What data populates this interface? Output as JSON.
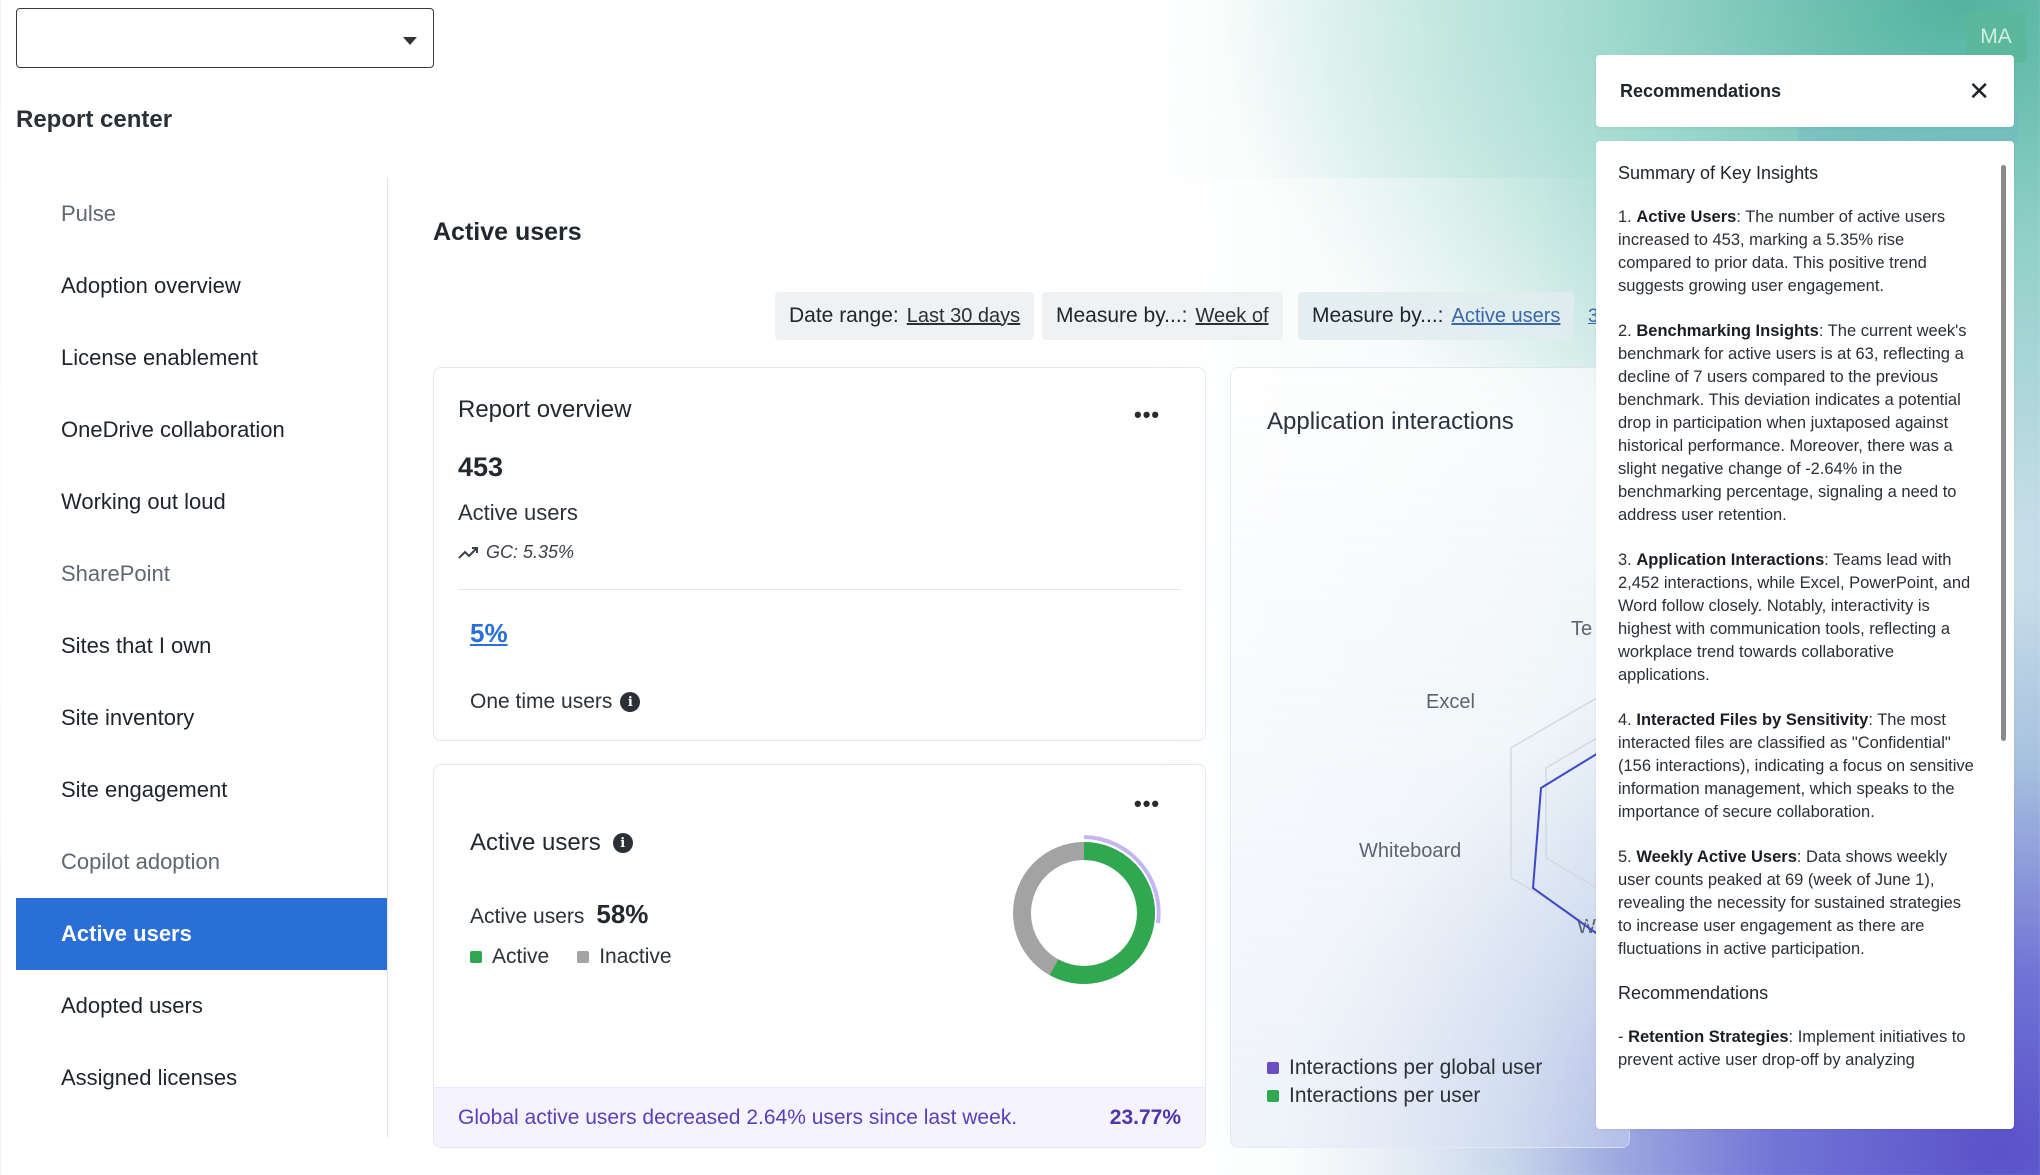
{
  "header": {
    "report_center": "Report center",
    "avatar_initials": "MA"
  },
  "sidebar": {
    "items": [
      {
        "label": "Pulse",
        "kind": "section"
      },
      {
        "label": "Adoption overview",
        "kind": "item"
      },
      {
        "label": "License enablement",
        "kind": "item"
      },
      {
        "label": "OneDrive collaboration",
        "kind": "item"
      },
      {
        "label": "Working out loud",
        "kind": "item"
      },
      {
        "label": "SharePoint",
        "kind": "section"
      },
      {
        "label": "Sites that I own",
        "kind": "item"
      },
      {
        "label": "Site inventory",
        "kind": "item"
      },
      {
        "label": "Site engagement",
        "kind": "item"
      },
      {
        "label": "Copilot adoption",
        "kind": "section"
      },
      {
        "label": "Active users",
        "kind": "active"
      },
      {
        "label": "Adopted users",
        "kind": "item"
      },
      {
        "label": "Assigned licenses",
        "kind": "item"
      }
    ]
  },
  "main": {
    "title": "Active users",
    "filters": [
      {
        "label": "Date range:",
        "value": "Last 30 days"
      },
      {
        "label": "Measure by...:",
        "value": "Week of"
      },
      {
        "label": "Measure by...:",
        "value": "Active users"
      }
    ],
    "more_link": "3"
  },
  "overview": {
    "title": "Report overview",
    "menu": "•••",
    "value": "453",
    "label": "Active users",
    "gc": "GC: 5.35%",
    "pct": "5%",
    "one_time": "One time users"
  },
  "active_card": {
    "title": "Active users",
    "menu": "•••",
    "row_label": "Active users",
    "row_value": "58%",
    "active_fraction": 0.58,
    "legend": [
      {
        "label": "Active",
        "color": "#2fa84f"
      },
      {
        "label": "Inactive",
        "color": "#a3a3a3"
      }
    ],
    "footer_text": "Global active users decreased 2.64% users since last week.",
    "footer_pct": "23.77%"
  },
  "app_card": {
    "title": "Application interactions",
    "axis_labels": [
      "Te",
      "Excel",
      "Whiteboard",
      "W"
    ],
    "legend": [
      {
        "label": "Interactions per global user",
        "color": "#6a4fc4"
      },
      {
        "label": "Interactions per user",
        "color": "#2fa84f"
      }
    ]
  },
  "recommendations": {
    "title": "Recommendations",
    "close": "✕",
    "summary_heading": "Summary of Key Insights",
    "points": [
      {
        "lead": "1. ",
        "bold": "Active Users",
        "text": ": The number of active users increased to 453, marking a 5.35% rise compared to prior data. This positive trend suggests growing user engagement."
      },
      {
        "lead": "2. ",
        "bold": "Benchmarking Insights",
        "text": ": The current week's benchmark for active users is at 63, reflecting a decline of 7 users compared to the previous benchmark. This deviation indicates a potential drop in participation when juxtaposed against historical performance. Moreover, there was a slight negative change of -2.64% in the benchmarking percentage, signaling a need to address user retention."
      },
      {
        "lead": "3. ",
        "bold": "Application Interactions",
        "text": ": Teams lead with 2,452 interactions, while Excel, PowerPoint, and Word follow closely. Notably, interactivity is highest with communication tools, reflecting a workplace trend towards collaborative applications."
      },
      {
        "lead": "4. ",
        "bold": "Interacted Files by Sensitivity",
        "text": ": The most interacted files are classified as \"Confidential\" (156 interactions), indicating a focus on sensitive information management, which speaks to the importance of secure collaboration."
      },
      {
        "lead": "5. ",
        "bold": "Weekly Active Users",
        "text": ": Data shows weekly user counts peaked at 69 (week of June 1), revealing the necessity for sustained strategies to increase user engagement as there are fluctuations in active participation."
      }
    ],
    "rec_heading": "Recommendations",
    "rec_points": [
      {
        "lead": "- ",
        "bold": "Retention Strategies",
        "text": ": Implement initiatives to prevent active user drop-off by analyzing"
      }
    ]
  }
}
